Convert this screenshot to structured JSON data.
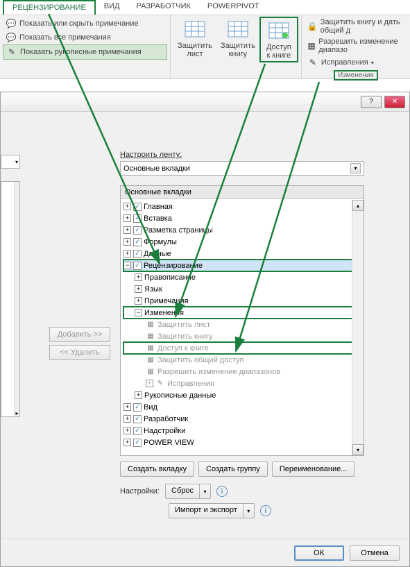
{
  "ribbon": {
    "tabs": [
      "РЕЦЕНЗИРОВАНИЕ",
      "ВИД",
      "РАЗРАБОТЧИК",
      "POWERPIVOT"
    ],
    "comments": {
      "show_hide": "Показать или скрыть примечание",
      "show_all": "Показать все примечания",
      "show_ink": "Показать рукописные примечания"
    },
    "protect": {
      "sheet": "Защитить\nлист",
      "book": "Защитить\nкнигу",
      "share": "Доступ\nк книге"
    },
    "changes": {
      "protect_share": "Защитить книгу и дать общий д",
      "allow_ranges": "Разрешить изменение диапазо",
      "track": "Исправления",
      "group_label": "Изменения"
    }
  },
  "dialog": {
    "configure_label": "Настроить ленту:",
    "main_tabs": "Основные вкладки",
    "tree_header": "Основные вкладки",
    "tree": {
      "n1": "Главная",
      "n2": "Вставка",
      "n3": "Разметка страницы",
      "n4": "Формулы",
      "n5": "Данные",
      "n6": "Рецензирование",
      "n6a": "Правописание",
      "n6b": "Язык",
      "n6c": "Примечания",
      "n6d": "Изменения",
      "n6d1": "Защитить лист",
      "n6d2": "Защитить книгу",
      "n6d3": "Доступ к книге",
      "n6d4": "Защитить общий доступ",
      "n6d5": "Разрешить изменение диапазонов",
      "n6d6": "Исправления",
      "n6e": "Рукописные данные",
      "n7": "Вид",
      "n8": "Разработчик",
      "n9": "Надстройки",
      "n10": "POWER VIEW"
    },
    "btn_add": "Добавить >>",
    "btn_remove": "<< Удалить",
    "btn_new_tab": "Создать вкладку",
    "btn_new_group": "Создать группу",
    "btn_rename": "Переименование...",
    "settings_label": "Настройки:",
    "btn_reset": "Сброс",
    "btn_import": "Импорт и экспорт",
    "btn_ok": "OK",
    "btn_cancel": "Отмена"
  }
}
